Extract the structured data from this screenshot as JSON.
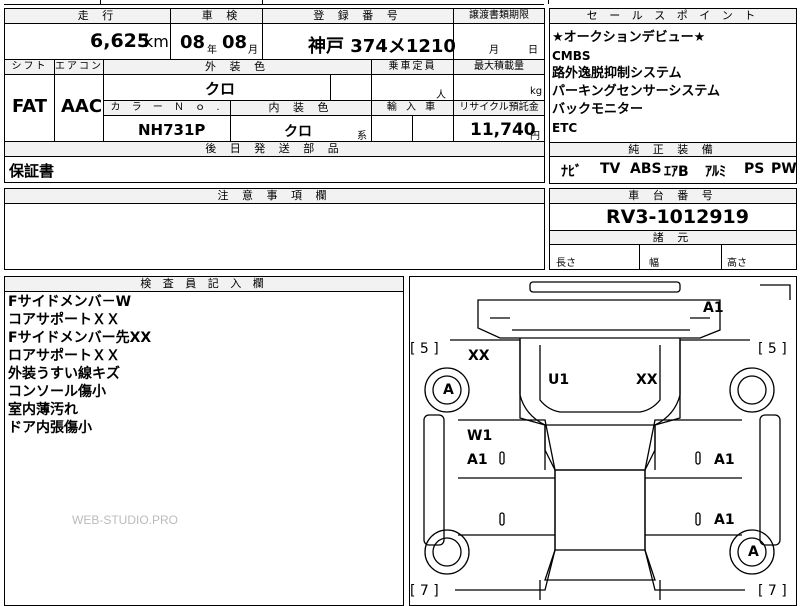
{
  "mileage": {
    "header": "走 行",
    "value": "6,625",
    "unit": "km"
  },
  "inspection": {
    "header": "車 検",
    "year": "08",
    "year_unit": "年",
    "month": "08",
    "month_unit": "月"
  },
  "registration": {
    "header": "登 録 番 号",
    "value": "神戸 374メ1210"
  },
  "transfer": {
    "header": "譲渡書類期限",
    "month_unit": "月",
    "day_unit": "日"
  },
  "shift": {
    "header": "シフト",
    "value": "FAT"
  },
  "aircon": {
    "header": "エアコン",
    "value": "AAC"
  },
  "exterior": {
    "header": "外 装 色",
    "value": "クロ"
  },
  "capacity": {
    "header": "乗車定員",
    "unit": "人"
  },
  "max_load": {
    "header": "最大積載量",
    "unit": "kg"
  },
  "color_no": {
    "header": "カ ラ ー Ｎ ｏ .",
    "value": "NH731P"
  },
  "interior": {
    "header": "内 装 色",
    "value": "クロ",
    "suffix": "系"
  },
  "import": {
    "header": "輸 入 車"
  },
  "recycle": {
    "header": "リサイクル預託金",
    "value": "11,740",
    "unit": "円"
  },
  "later_parts": {
    "header": "後 日 発 送 部 品",
    "value": "保証書"
  },
  "caution": {
    "header": "注 意 事 項 欄"
  },
  "sales_points": {
    "header": "セ ー ル ス ポ イ ン ト",
    "items": [
      "★オークションデビュー★",
      "CMBS",
      "路外逸脱抑制システム",
      "パーキングセンサーシステム",
      "バックモニター",
      "ETC"
    ]
  },
  "equipment": {
    "header": "純 正 装 備",
    "items": [
      "ﾅﾋﾞ",
      "TV",
      "ABS",
      "ｴｱB",
      "ｱﾙﾐ",
      "PS",
      "PW"
    ]
  },
  "chassis": {
    "header": "車 台 番 号",
    "value": "RV3-1012919"
  },
  "dimensions": {
    "header": "諸 元",
    "length": "長さ",
    "width": "幅",
    "height": "高さ"
  },
  "inspector": {
    "header": "検 査 員 記 入 欄",
    "notes": [
      "Fサイドメンバ－W",
      "コアサポートＸＸ",
      "Fサイドメンバー先XX",
      "ロアサポートＸＸ",
      "外装うすい線キズ",
      "コンソール傷小",
      "室内薄汚れ",
      "ドア内張傷小"
    ]
  },
  "watermark": "WEB-STUDIO.PRO",
  "damage": {
    "a1_top": "A1",
    "xx_left": "XX",
    "u1": "U1",
    "xx_right": "XX",
    "a_left": "A",
    "w1": "W1",
    "a1_door_fl": "A1",
    "a1_door_fr": "A1",
    "a1_door_rr": "A1",
    "a_right": "A",
    "tire_fl": "[ 5 ]",
    "tire_fr": "[ 5 ]",
    "tire_rl": "[ 7 ]",
    "tire_rr": "[ 7 ]"
  }
}
